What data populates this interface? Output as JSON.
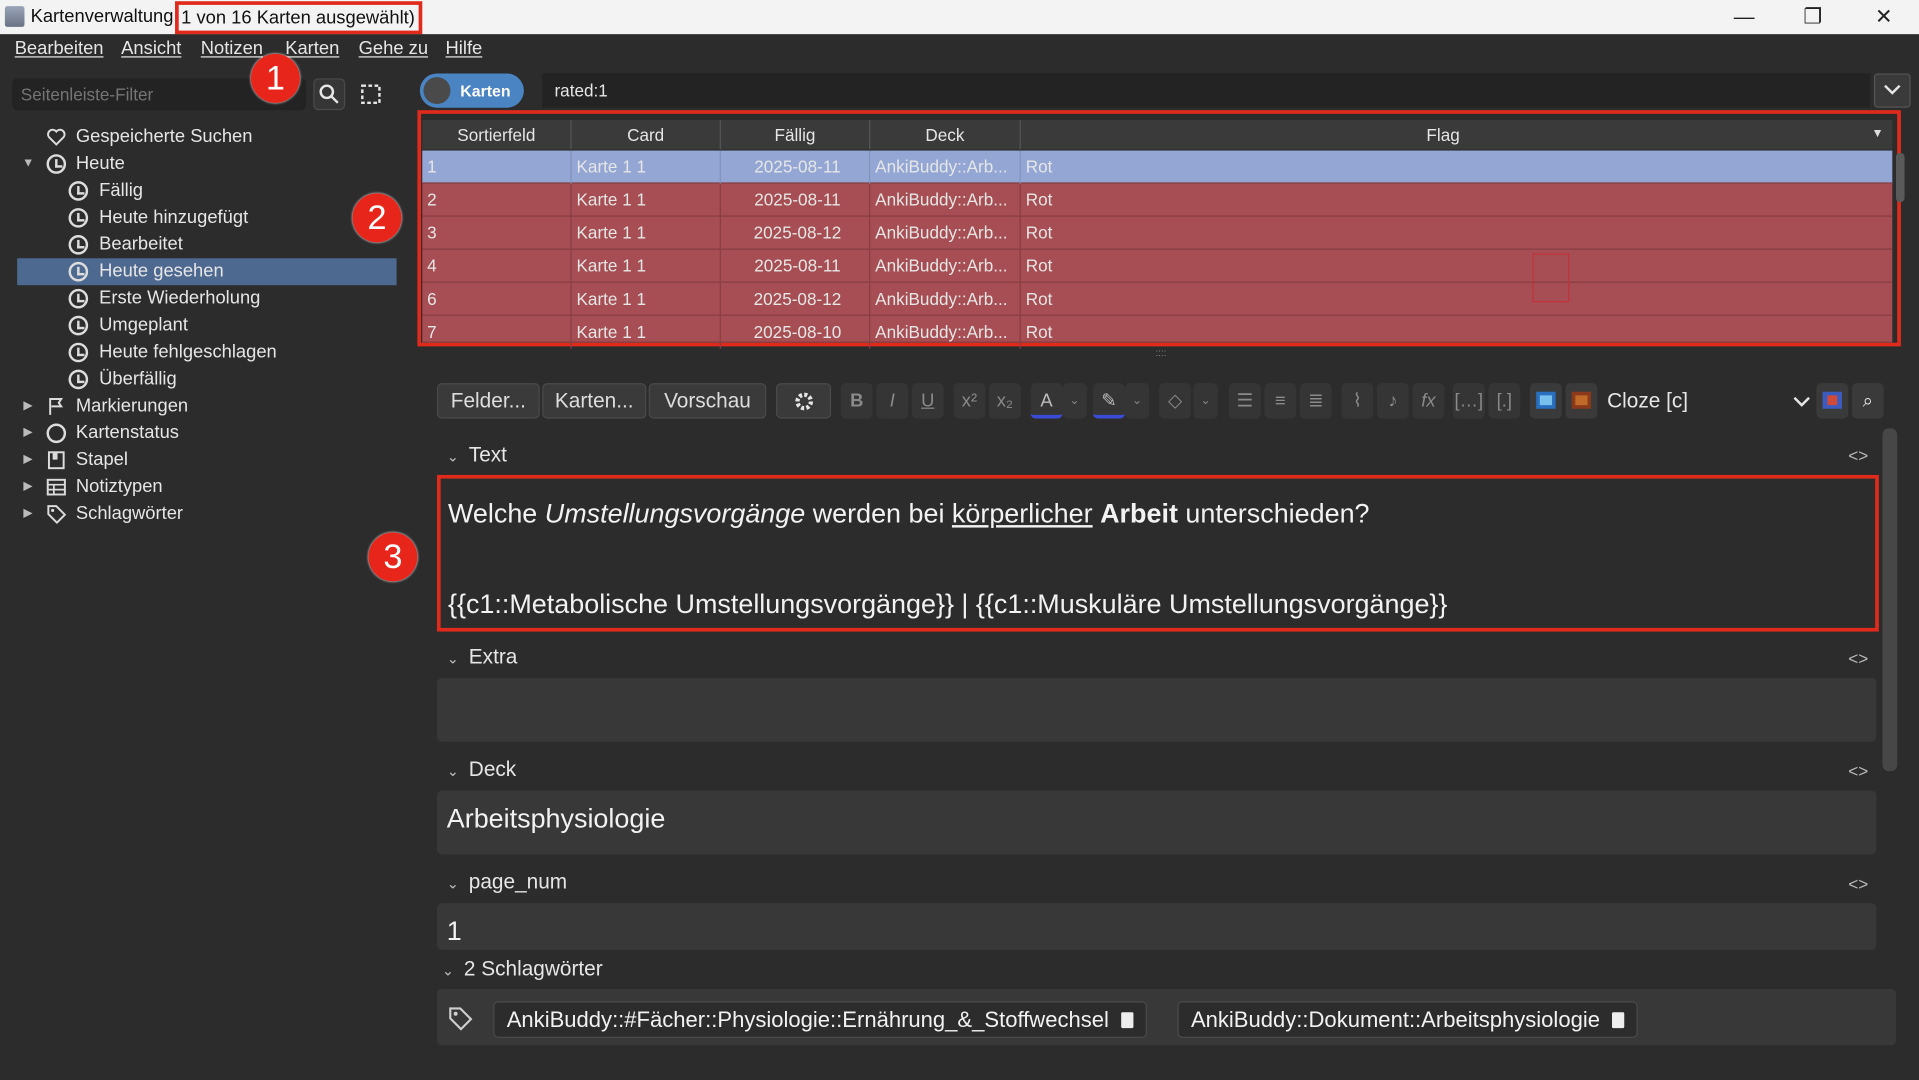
{
  "window": {
    "title_prefix": "Kartenverwaltung",
    "title_selection": "1 von 16 Karten ausgewählt)",
    "minimize": "—",
    "maximize": "❐",
    "close": "✕"
  },
  "menu": [
    "Bearbeiten",
    "Ansicht",
    "Notizen",
    "Karten",
    "Gehe zu",
    "Hilfe"
  ],
  "sidebar": {
    "filter_placeholder": "Seitenleiste-Filter",
    "items": [
      {
        "label": "Gespeicherte Suchen",
        "icon": "heart-icon"
      },
      {
        "label": "Heute",
        "icon": "clock-icon",
        "expanded": true
      },
      {
        "label": "Fällig",
        "icon": "clock-icon"
      },
      {
        "label": "Heute hinzugefügt",
        "icon": "clock-icon"
      },
      {
        "label": "Bearbeitet",
        "icon": "clock-icon"
      },
      {
        "label": "Heute gesehen",
        "icon": "clock-icon",
        "selected": true
      },
      {
        "label": "Erste Wiederholung",
        "icon": "clock-icon"
      },
      {
        "label": "Umgeplant",
        "icon": "clock-icon"
      },
      {
        "label": "Heute fehlgeschlagen",
        "icon": "clock-icon"
      },
      {
        "label": "Überfällig",
        "icon": "clock-icon"
      },
      {
        "label": "Markierungen",
        "icon": "flag-icon"
      },
      {
        "label": "Kartenstatus",
        "icon": "circle-icon"
      },
      {
        "label": "Stapel",
        "icon": "book-icon"
      },
      {
        "label": "Notiztypen",
        "icon": "table-icon"
      },
      {
        "label": "Schlagwörter",
        "icon": "tag-icon"
      }
    ]
  },
  "badges": [
    "1",
    "2",
    "3"
  ],
  "search": {
    "toggle_label": "Karten",
    "query": "rated:1"
  },
  "table": {
    "columns": [
      "Sortierfeld",
      "Card",
      "Fällig",
      "Deck",
      "Flag"
    ],
    "rows": [
      [
        "1",
        "Karte 1 1",
        "2025-08-11",
        "AnkiBuddy::Arb...",
        "Rot"
      ],
      [
        "2",
        "Karte 1 1",
        "2025-08-11",
        "AnkiBuddy::Arb...",
        "Rot"
      ],
      [
        "3",
        "Karte 1 1",
        "2025-08-12",
        "AnkiBuddy::Arb...",
        "Rot"
      ],
      [
        "4",
        "Karte 1 1",
        "2025-08-11",
        "AnkiBuddy::Arb...",
        "Rot"
      ],
      [
        "6",
        "Karte 1 1",
        "2025-08-12",
        "AnkiBuddy::Arb...",
        "Rot"
      ],
      [
        "7",
        "Karte 1 1",
        "2025-08-10",
        "AnkiBuddy::Arb...",
        "Rot"
      ]
    ],
    "row_color": "#a64e53",
    "selected_color": "#93a6d4"
  },
  "toolbar": {
    "fields": "Felder...",
    "cards": "Karten...",
    "preview": "Vorschau",
    "notetype": "Cloze [c]"
  },
  "fields": {
    "text_label": "Text",
    "text_q1": "Welche ",
    "text_q2": "Umstellungsvorgänge",
    "text_q3": " werden bei ",
    "text_q4": "körperlicher",
    "text_q5": " ",
    "text_q6": "Arbeit",
    "text_q7": " unterschieden?",
    "text_cloze": "{{c1::Metabolische Umstellungsvorgänge}} | {{c1::Muskuläre Umstellungsvorgänge}}",
    "extra_label": "Extra",
    "extra_value": "",
    "deck_label": "Deck",
    "deck_value": "Arbeitsphysiologie",
    "page_label": "page_num",
    "page_value": "1",
    "html_toggle": "<>"
  },
  "tags": {
    "header": "2 Schlagwörter",
    "items": [
      "AnkiBuddy::#Fächer::Physiologie::Ernährung_&_Stoffwechsel",
      "AnkiBuddy::Dokument::Arbeitsphysiologie"
    ]
  }
}
